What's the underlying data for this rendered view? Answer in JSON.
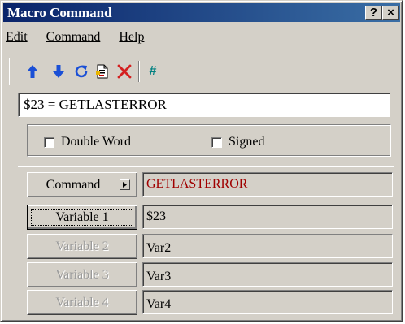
{
  "window": {
    "title": "Macro Command",
    "help_btn": "?",
    "close_btn": "×"
  },
  "menu": {
    "items": [
      {
        "label": "Edit"
      },
      {
        "label": "Command"
      },
      {
        "label": "Help"
      }
    ]
  },
  "toolbar": {
    "hash_label": "#",
    "colors": {
      "arrow_blue": "#1a4fd6",
      "delete_red": "#d42020",
      "hash_teal": "#008080"
    }
  },
  "command_line": {
    "value": "$23 = GETLASTERROR"
  },
  "options": {
    "double_word": "Double Word",
    "signed": "Signed"
  },
  "params": {
    "command_label": "Command",
    "command_value": "GETLASTERROR",
    "var1_label": "Variable 1",
    "var1_value": "$23",
    "var2_label": "Variable 2",
    "var2_value": "Var2",
    "var3_label": "Variable 3",
    "var3_value": "Var3",
    "var4_label": "Variable 4",
    "var4_value": "Var4"
  }
}
